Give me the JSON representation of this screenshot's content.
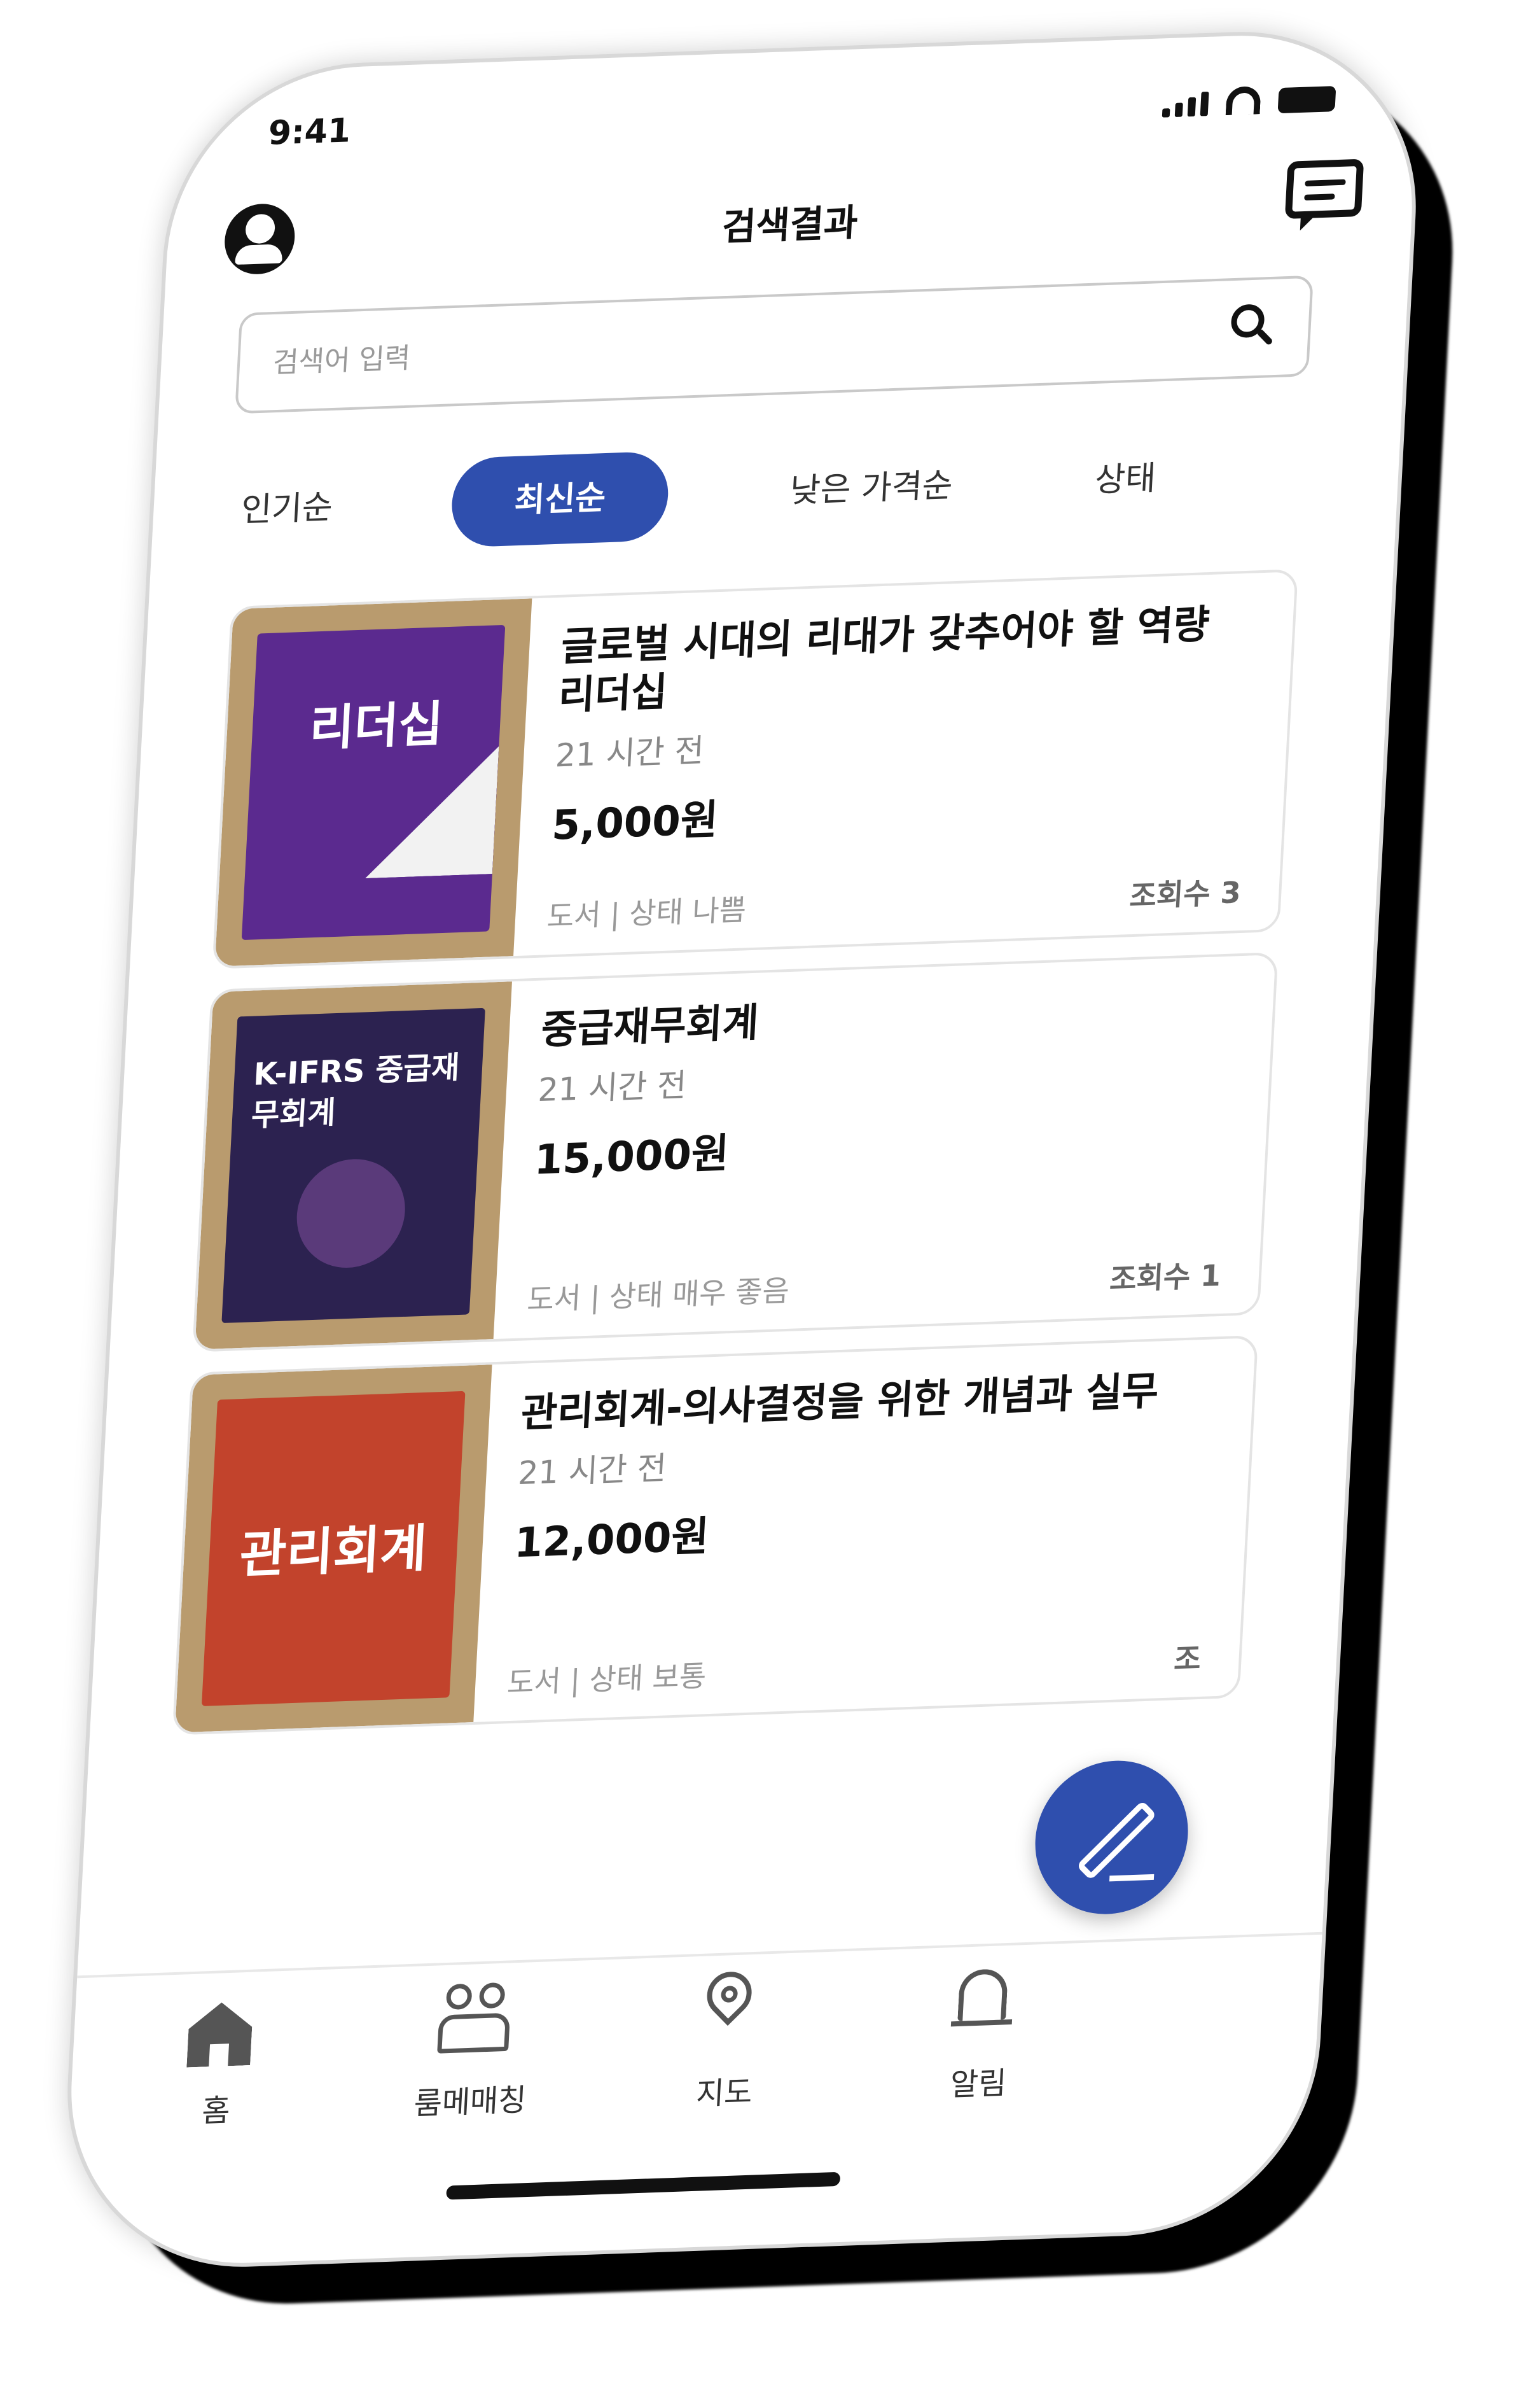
{
  "status_bar": {
    "time": "9:41"
  },
  "header": {
    "title": "검색결과"
  },
  "search": {
    "placeholder": "검색어 입력"
  },
  "sort_tabs": [
    {
      "label": "인기순",
      "active": false
    },
    {
      "label": "최신순",
      "active": true
    },
    {
      "label": "낮은 가격순",
      "active": false
    },
    {
      "label": "상태",
      "active": false
    }
  ],
  "listings": [
    {
      "title": "글로벌 시대의 리대가 갖추어야 할 역량 리더십",
      "time": "21 시간 전",
      "price": "5,000원",
      "meta": "도서 | 상태 나쁨",
      "views": "조회수 3",
      "cover_text": "리더십",
      "cover_color": "#5b2a8f"
    },
    {
      "title": "중급재무회계",
      "time": "21 시간 전",
      "price": "15,000원",
      "meta": "도서 | 상태 매우 좋음",
      "views": "조회수 1",
      "cover_text": "K-IFRS 중급재무회계",
      "cover_color": "#2c2250"
    },
    {
      "title": "관리회계-의사결정을 위한 개념과 실무",
      "time": "21 시간 전",
      "price": "12,000원",
      "meta": "도서 | 상태 보통",
      "views": "조",
      "cover_text": "관리회계",
      "cover_color": "#c2432c"
    }
  ],
  "bottom_nav": [
    {
      "label": "홈",
      "icon": "home-icon"
    },
    {
      "label": "룸메매칭",
      "icon": "people-icon"
    },
    {
      "label": "지도",
      "icon": "map-pin-icon"
    },
    {
      "label": "알림",
      "icon": "bell-icon"
    }
  ],
  "colors": {
    "accent": "#2f4fae"
  }
}
